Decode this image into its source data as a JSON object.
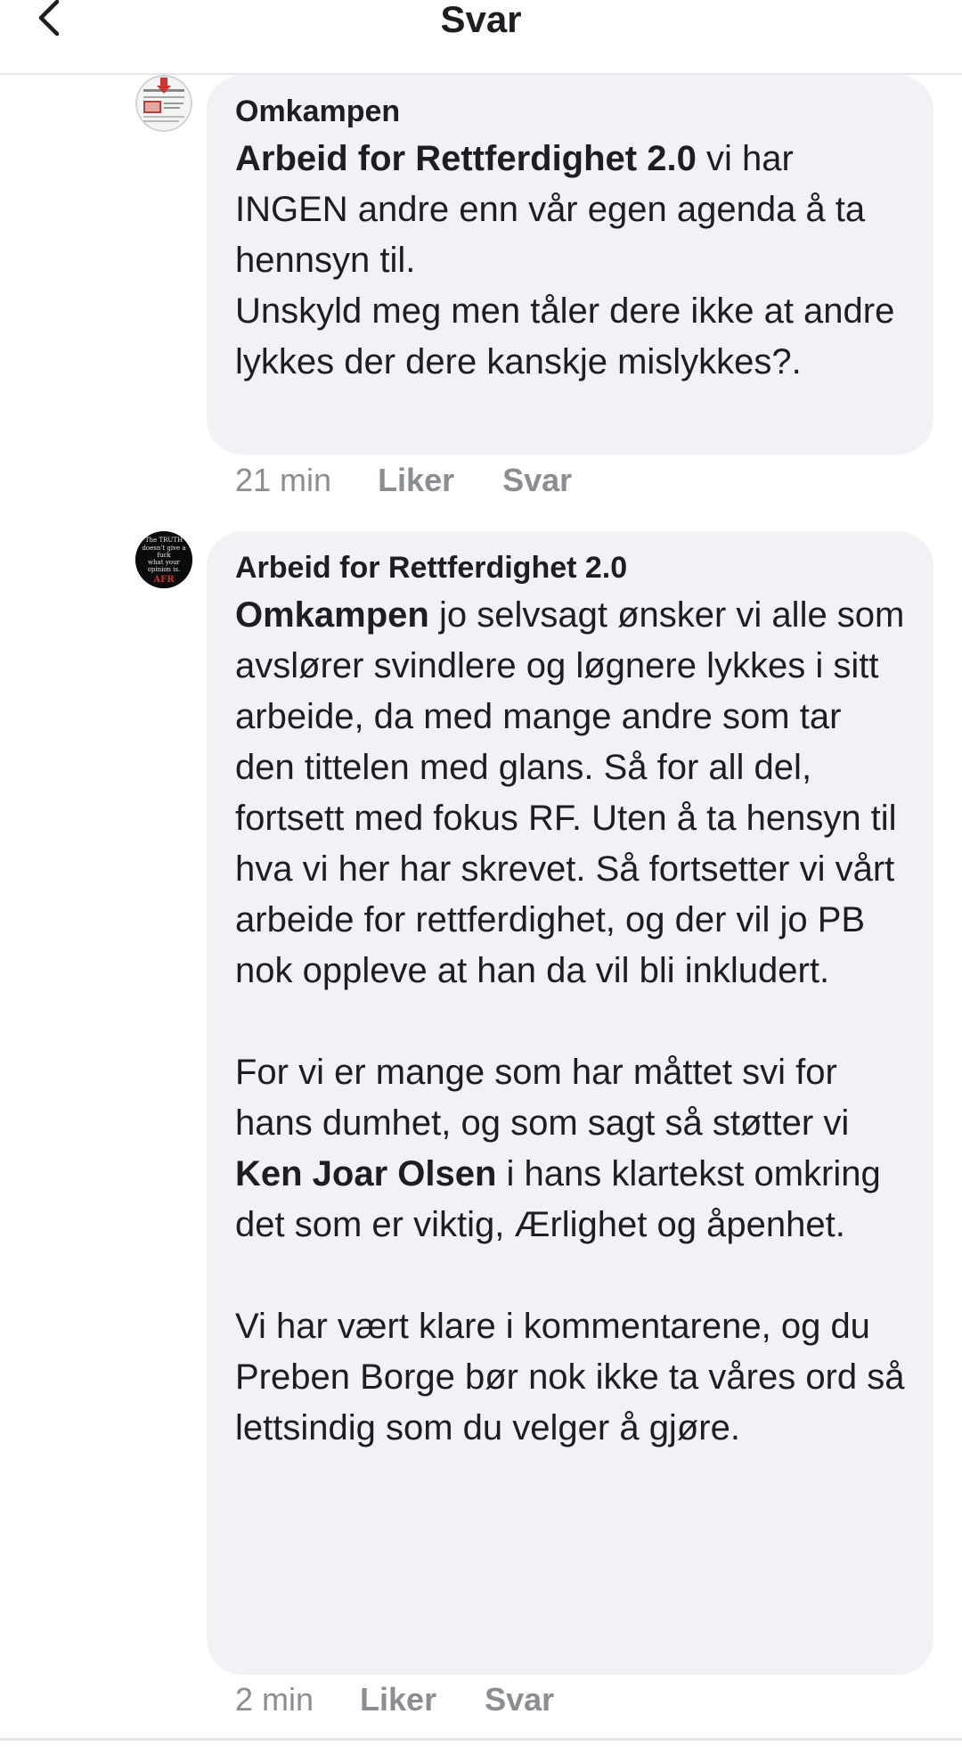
{
  "header": {
    "title": "Svar"
  },
  "comments": [
    {
      "author": "Omkampen",
      "paragraphs": [
        [
          {
            "text": "Arbeid for Rettferdighet 2.0",
            "mention": true
          },
          {
            "text": " vi har INGEN andre enn vår egen agenda å ta hennsyn til.",
            "mention": false
          }
        ],
        [
          {
            "text": "Unskyld meg men tåler dere ikke at andre lykkes der dere kanskje mislykkes?.",
            "mention": false
          }
        ]
      ],
      "time": "21 min",
      "like_label": "Liker",
      "reply_label": "Svar"
    },
    {
      "author": "Arbeid for Rettferdighet 2.0",
      "avatar_text": [
        "The TRUTH",
        "doesn't give a",
        "fuck",
        "what your",
        "opinion is.",
        "AFR"
      ],
      "paragraphs": [
        [
          {
            "text": "Omkampen",
            "mention": true
          },
          {
            "text": " jo selvsagt ønsker vi alle som avslører svindlere og løgnere lykkes i sitt arbeide, da med mange andre som tar den tittelen med glans. Så for all del, fortsett med fokus RF. Uten å ta hensyn til hva vi her har skrevet. Så fortsetter vi vårt arbeide for rettferdighet, og der vil jo PB nok oppleve at han da vil bli inkludert.",
            "mention": false
          }
        ],
        [
          {
            "text": "For vi er mange som har måttet svi for hans dumhet, og som sagt så støtter vi ",
            "mention": false
          },
          {
            "text": "Ken Joar Olsen",
            "mention": true
          },
          {
            "text": " i hans klartekst omkring det som er viktig, Ærlighet og åpenhet.",
            "mention": false
          }
        ],
        [
          {
            "text": "Vi har vært klare i kommentarene, og du Preben Borge bør nok ikke ta våres ord så lettsindig som du velger å gjøre.",
            "mention": false
          }
        ]
      ],
      "time": "2 min",
      "like_label": "Liker",
      "reply_label": "Svar"
    }
  ]
}
